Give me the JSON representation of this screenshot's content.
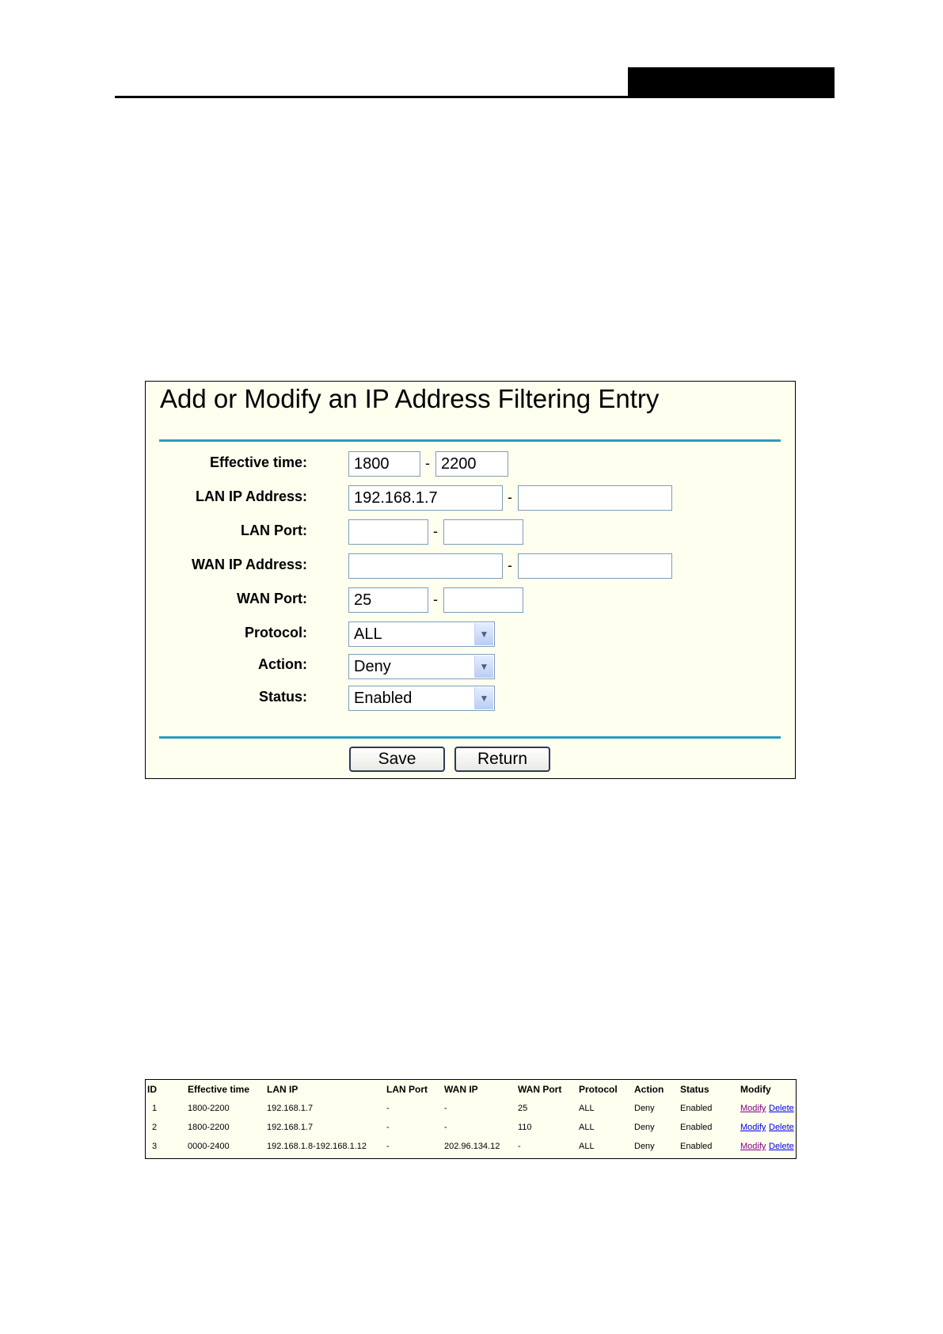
{
  "form": {
    "title": "Add or Modify an IP Address Filtering Entry",
    "fields": {
      "effective_time": {
        "label": "Effective time:",
        "from": "1800",
        "to": "2200"
      },
      "lan_ip": {
        "label": "LAN IP Address:",
        "from": "192.168.1.7",
        "to": ""
      },
      "lan_port": {
        "label": "LAN Port:",
        "from": "",
        "to": ""
      },
      "wan_ip": {
        "label": "WAN IP Address:",
        "from": "",
        "to": ""
      },
      "wan_port": {
        "label": "WAN Port:",
        "from": "25",
        "to": ""
      },
      "protocol": {
        "label": "Protocol:",
        "value": "ALL"
      },
      "action": {
        "label": "Action:",
        "value": "Deny"
      },
      "status": {
        "label": "Status:",
        "value": "Enabled"
      }
    },
    "range_separator": "-",
    "buttons": {
      "save": "Save",
      "return": "Return"
    }
  },
  "table": {
    "headers": [
      "ID",
      "Effective time",
      "LAN IP",
      "LAN Port",
      "WAN IP",
      "WAN Port",
      "Protocol",
      "Action",
      "Status",
      "Modify"
    ],
    "rows": [
      {
        "id": "1",
        "time": "1800-2200",
        "lan_ip": "192.168.1.7",
        "lan_port": "-",
        "wan_ip": "-",
        "wan_port": "25",
        "protocol": "ALL",
        "action": "Deny",
        "status": "Enabled",
        "modify": "Modify",
        "delete": "Delete"
      },
      {
        "id": "2",
        "time": "1800-2200",
        "lan_ip": "192.168.1.7",
        "lan_port": "-",
        "wan_ip": "-",
        "wan_port": "110",
        "protocol": "ALL",
        "action": "Deny",
        "status": "Enabled",
        "modify": "Modify",
        "delete": "Delete"
      },
      {
        "id": "3",
        "time": "0000-2400",
        "lan_ip": "192.168.1.8-192.168.1.12",
        "lan_port": "-",
        "wan_ip": "202.96.134.12",
        "wan_port": "-",
        "protocol": "ALL",
        "action": "Deny",
        "status": "Enabled",
        "modify": "Modify",
        "delete": "Delete"
      }
    ]
  },
  "colors": {
    "panel_bg": "#fffff0",
    "rule": "#2a9dc0",
    "link_visited": "#800080",
    "link": "#0000ee"
  },
  "icons": {
    "select_arrow": "chevron-down-icon"
  }
}
